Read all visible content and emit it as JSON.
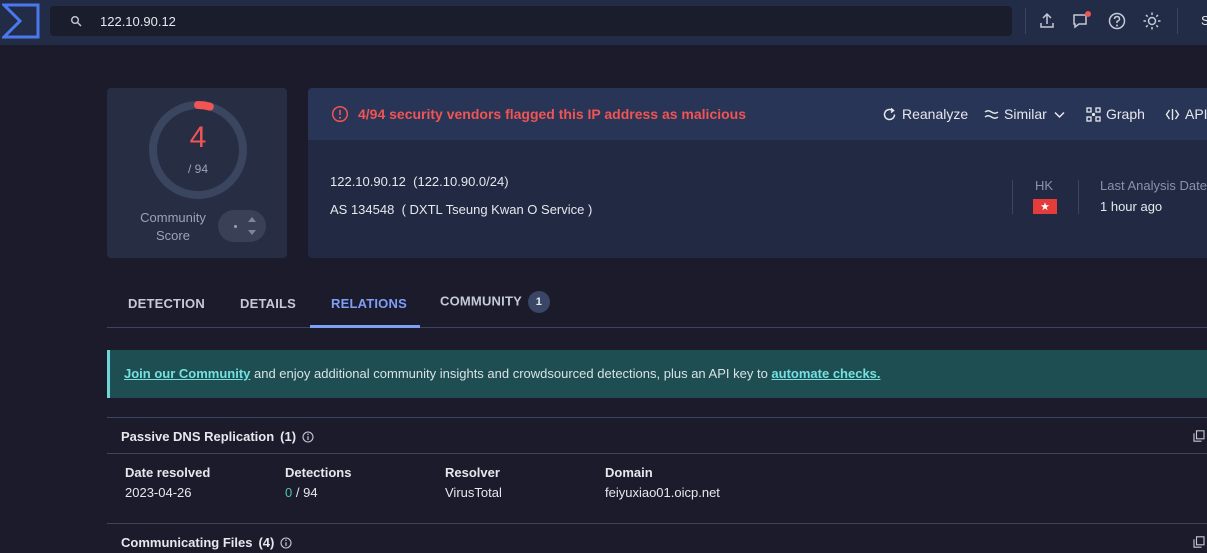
{
  "search": {
    "value": "122.10.90.12"
  },
  "topbar": {
    "edge_text": "S"
  },
  "score": {
    "detections": "4",
    "total": "/ 94",
    "fraction": 0.0426,
    "community_label_1": "Community",
    "community_label_2": "Score"
  },
  "alert": {
    "text": "4/94 security vendors flagged this IP address as malicious",
    "color": "#f05454"
  },
  "actions": {
    "reanalyze": "Reanalyze",
    "similar": "Similar",
    "graph": "Graph",
    "api": "API"
  },
  "ip_info": {
    "ip": "122.10.90.12",
    "network": "(122.10.90.0/24)",
    "as": "AS 134548",
    "as_name": "( DXTL Tseung Kwan O Service )",
    "country_code": "HK",
    "last_analysis_label": "Last Analysis Date",
    "last_analysis_value": "1 hour ago"
  },
  "tabs": [
    {
      "label": "DETECTION"
    },
    {
      "label": "DETAILS"
    },
    {
      "label": "RELATIONS"
    },
    {
      "label": "COMMUNITY",
      "badge": "1"
    }
  ],
  "banner": {
    "link1": "Join our Community",
    "middle": " and enjoy additional community insights and crowdsourced detections, plus an API key to ",
    "link2": "automate checks."
  },
  "passive_dns": {
    "title": "Passive DNS Replication",
    "count": "(1)",
    "columns": [
      "Date resolved",
      "Detections",
      "Resolver",
      "Domain"
    ],
    "rows": [
      {
        "date": "2023-04-26",
        "detections_pos": "0",
        "detections_total": "/ 94",
        "resolver": "VirusTotal",
        "domain": "feiyuxiao01.oicp.net"
      }
    ]
  },
  "communicating_files": {
    "title": "Communicating Files",
    "count": "(4)"
  },
  "colors": {
    "accent": "#7f9ef8",
    "malicious": "#f05454",
    "clean": "#4ec9a4",
    "banner": "#1e4d52"
  }
}
